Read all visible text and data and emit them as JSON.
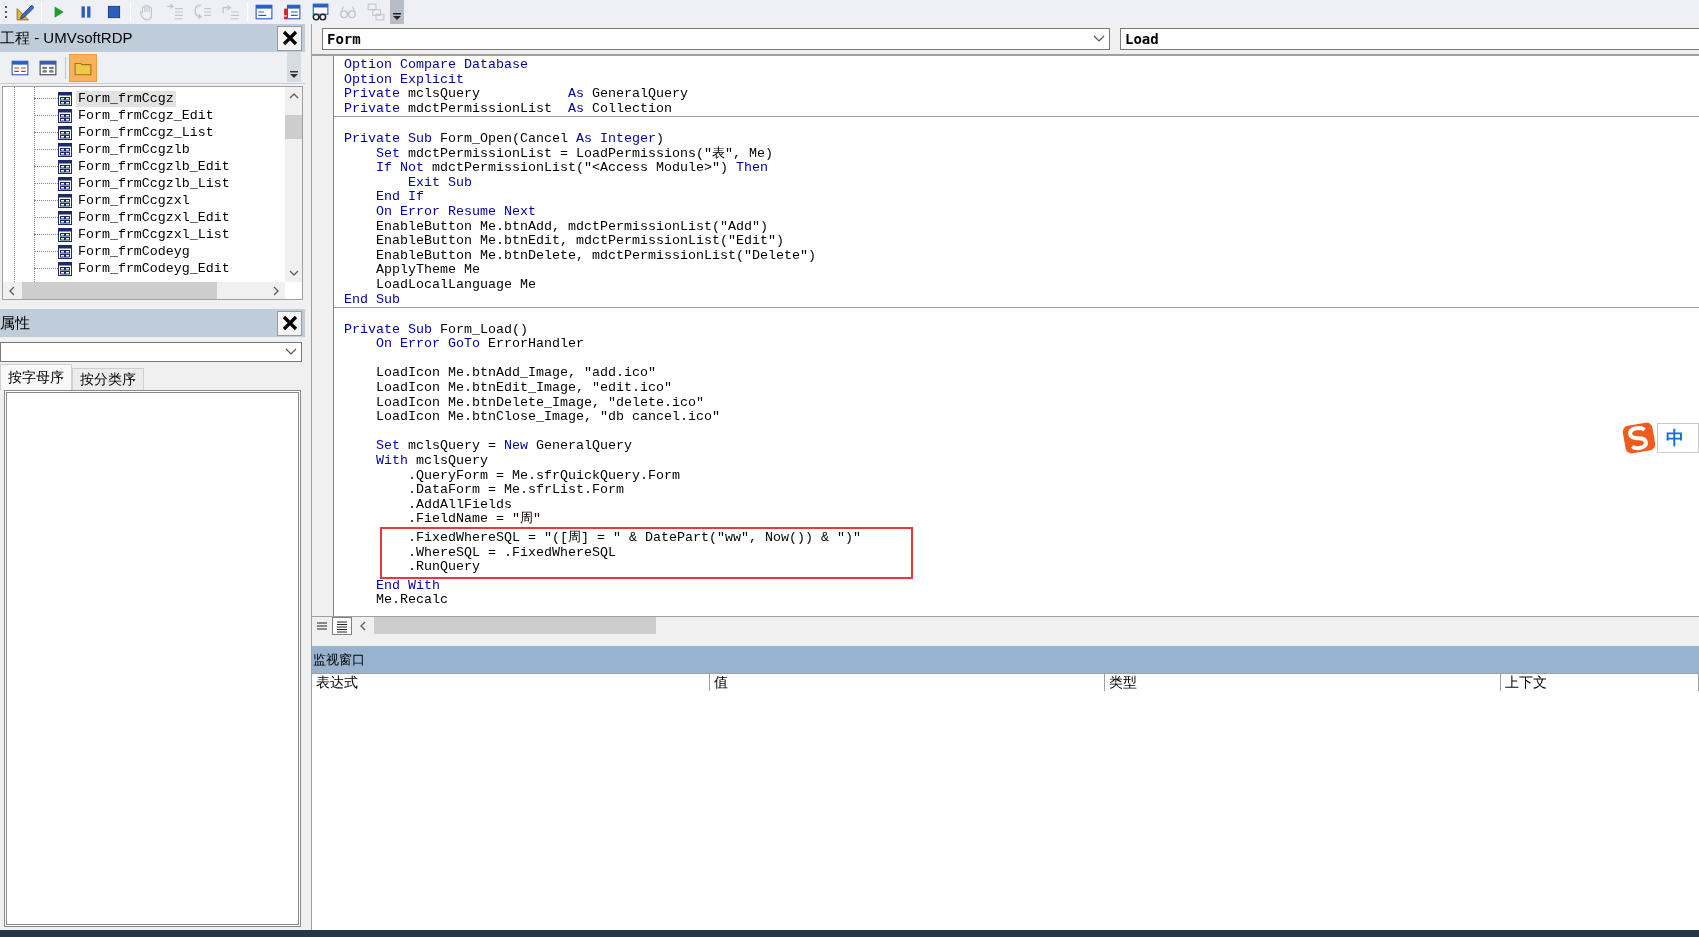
{
  "toolbar": [
    {
      "kind": "grip"
    },
    {
      "kind": "design",
      "disabled": false
    },
    {
      "kind": "separator"
    },
    {
      "kind": "run",
      "disabled": false
    },
    {
      "kind": "pause",
      "disabled": false
    },
    {
      "kind": "reset",
      "disabled": false
    },
    {
      "kind": "separator"
    },
    {
      "kind": "breakpoint",
      "disabled": true
    },
    {
      "kind": "step-into",
      "disabled": true
    },
    {
      "kind": "step-over",
      "disabled": true
    },
    {
      "kind": "step-out",
      "disabled": true
    },
    {
      "kind": "separator"
    },
    {
      "kind": "locals",
      "disabled": false
    },
    {
      "kind": "immediate",
      "disabled": false
    },
    {
      "kind": "watch",
      "disabled": false
    },
    {
      "kind": "quick-watch",
      "disabled": true
    },
    {
      "kind": "call-stack",
      "disabled": true
    }
  ],
  "project": {
    "title": "工程 - UMVsoftRDP",
    "toolbar": [
      {
        "kind": "view-code",
        "selected": false
      },
      {
        "kind": "view-object",
        "selected": false
      },
      {
        "kind": "toggle-folders",
        "selected": true
      }
    ],
    "items": [
      {
        "label": "Form_frmCcgz",
        "selected": true
      },
      {
        "label": "Form_frmCcgz_Edit",
        "selected": false
      },
      {
        "label": "Form_frmCcgz_List",
        "selected": false
      },
      {
        "label": "Form_frmCcgzlb",
        "selected": false
      },
      {
        "label": "Form_frmCcgzlb_Edit",
        "selected": false
      },
      {
        "label": "Form_frmCcgzlb_List",
        "selected": false
      },
      {
        "label": "Form_frmCcgzxl",
        "selected": false
      },
      {
        "label": "Form_frmCcgzxl_Edit",
        "selected": false
      },
      {
        "label": "Form_frmCcgzxl_List",
        "selected": false
      },
      {
        "label": "Form_frmCodeyg",
        "selected": false
      },
      {
        "label": "Form_frmCodeyg_Edit",
        "selected": false
      }
    ]
  },
  "properties": {
    "title": "属性",
    "tabs": [
      {
        "label": "按字母序",
        "selected": true
      },
      {
        "label": "按分类序",
        "selected": false
      }
    ]
  },
  "code_window": {
    "object": "Form",
    "procedure": "Load",
    "sections": [
      {
        "lines": [
          {
            "kind": "code",
            "tokens": [
              {
                "text": "Option Compare Database",
                "kind": "keyword"
              }
            ]
          },
          {
            "kind": "code",
            "tokens": [
              {
                "text": "Option Explicit",
                "kind": "keyword"
              }
            ]
          },
          {
            "kind": "code",
            "tokens": [
              {
                "text": "Private",
                "kind": "keyword"
              },
              {
                "text": " mclsQuery           ",
                "kind": "plain"
              },
              {
                "text": "As",
                "kind": "keyword"
              },
              {
                "text": " GeneralQuery",
                "kind": "plain"
              }
            ]
          },
          {
            "kind": "code",
            "tokens": [
              {
                "text": "Private",
                "kind": "keyword"
              },
              {
                "text": " mdctPermissionList  ",
                "kind": "plain"
              },
              {
                "text": "As",
                "kind": "keyword"
              },
              {
                "text": " Collection",
                "kind": "plain"
              }
            ]
          }
        ]
      },
      {
        "lines": [
          {
            "kind": "blank"
          },
          {
            "kind": "code",
            "tokens": [
              {
                "text": "Private Sub",
                "kind": "keyword"
              },
              {
                "text": " Form_Open(Cancel ",
                "kind": "plain"
              },
              {
                "text": "As Integer",
                "kind": "keyword"
              },
              {
                "text": ")",
                "kind": "plain"
              }
            ]
          },
          {
            "kind": "code",
            "tokens": [
              {
                "text": "    Set",
                "kind": "keyword"
              },
              {
                "text": " mdctPermissionList = LoadPermissions(\"表\", Me)",
                "kind": "plain"
              }
            ]
          },
          {
            "kind": "code",
            "tokens": [
              {
                "text": "    If Not",
                "kind": "keyword"
              },
              {
                "text": " mdctPermissionList(\"<Access Module>\") ",
                "kind": "plain"
              },
              {
                "text": "Then",
                "kind": "keyword"
              }
            ]
          },
          {
            "kind": "code",
            "tokens": [
              {
                "text": "        Exit Sub",
                "kind": "keyword"
              }
            ]
          },
          {
            "kind": "code",
            "tokens": [
              {
                "text": "    End If",
                "kind": "keyword"
              }
            ]
          },
          {
            "kind": "code",
            "tokens": [
              {
                "text": "    On Error Resume Next",
                "kind": "keyword"
              }
            ]
          },
          {
            "kind": "code",
            "tokens": [
              {
                "text": "    EnableButton Me.btnAdd, mdctPermissionList(\"Add\")",
                "kind": "plain"
              }
            ]
          },
          {
            "kind": "code",
            "tokens": [
              {
                "text": "    EnableButton Me.btnEdit, mdctPermissionList(\"Edit\")",
                "kind": "plain"
              }
            ]
          },
          {
            "kind": "code",
            "tokens": [
              {
                "text": "    EnableButton Me.btnDelete, mdctPermissionList(\"Delete\")",
                "kind": "plain"
              }
            ]
          },
          {
            "kind": "code",
            "tokens": [
              {
                "text": "    ApplyTheme Me",
                "kind": "plain"
              }
            ]
          },
          {
            "kind": "code",
            "tokens": [
              {
                "text": "    LoadLocalLanguage Me",
                "kind": "plain"
              }
            ]
          },
          {
            "kind": "code",
            "tokens": [
              {
                "text": "End Sub",
                "kind": "keyword"
              }
            ]
          }
        ]
      },
      {
        "lines": [
          {
            "kind": "blank"
          },
          {
            "kind": "code",
            "tokens": [
              {
                "text": "Private Sub",
                "kind": "keyword"
              },
              {
                "text": " Form_Load()",
                "kind": "plain"
              }
            ]
          },
          {
            "kind": "code",
            "tokens": [
              {
                "text": "    On Error GoTo",
                "kind": "keyword"
              },
              {
                "text": " ErrorHandler",
                "kind": "plain"
              }
            ]
          },
          {
            "kind": "blank"
          },
          {
            "kind": "code",
            "tokens": [
              {
                "text": "    LoadIcon Me.btnAdd_Image, \"add.ico\"",
                "kind": "plain"
              }
            ]
          },
          {
            "kind": "code",
            "tokens": [
              {
                "text": "    LoadIcon Me.btnEdit_Image, \"edit.ico\"",
                "kind": "plain"
              }
            ]
          },
          {
            "kind": "code",
            "tokens": [
              {
                "text": "    LoadIcon Me.btnDelete_Image, \"delete.ico\"",
                "kind": "plain"
              }
            ]
          },
          {
            "kind": "code",
            "tokens": [
              {
                "text": "    LoadIcon Me.btnClose_Image, \"db cancel.ico\"",
                "kind": "plain"
              }
            ]
          },
          {
            "kind": "blank"
          },
          {
            "kind": "code",
            "tokens": [
              {
                "text": "    Set",
                "kind": "keyword"
              },
              {
                "text": " mclsQuery = ",
                "kind": "plain"
              },
              {
                "text": "New",
                "kind": "keyword"
              },
              {
                "text": " GeneralQuery",
                "kind": "plain"
              }
            ]
          },
          {
            "kind": "code",
            "tokens": [
              {
                "text": "    With",
                "kind": "keyword"
              },
              {
                "text": " mclsQuery",
                "kind": "plain"
              }
            ]
          },
          {
            "kind": "code",
            "tokens": [
              {
                "text": "        .QueryForm = Me.sfrQuickQuery.Form",
                "kind": "plain"
              }
            ]
          },
          {
            "kind": "code",
            "tokens": [
              {
                "text": "        .DataForm = Me.sfrList.Form",
                "kind": "plain"
              }
            ]
          },
          {
            "kind": "code",
            "tokens": [
              {
                "text": "        .AddAllFields",
                "kind": "plain"
              }
            ]
          },
          {
            "kind": "code",
            "tokens": [
              {
                "text": "        .FieldName = \"周\"",
                "kind": "plain"
              }
            ]
          },
          {
            "kind": "boxed",
            "tokens": [
              {
                "text": "        .FixedWhereSQL = \"([周] = \" & DatePart(\"ww\", Now()) & \")\"",
                "kind": "plain"
              }
            ]
          },
          {
            "kind": "boxed",
            "tokens": [
              {
                "text": "        .WhereSQL = .FixedWhereSQL",
                "kind": "plain"
              }
            ]
          },
          {
            "kind": "boxed",
            "tokens": [
              {
                "text": "        .RunQuery",
                "kind": "plain"
              }
            ]
          },
          {
            "kind": "code",
            "tokens": [
              {
                "text": "    End With",
                "kind": "keyword"
              }
            ]
          },
          {
            "kind": "code",
            "tokens": [
              {
                "text": "    Me.Recalc",
                "kind": "plain"
              }
            ]
          }
        ]
      }
    ],
    "view_buttons": [
      {
        "kind": "procedure",
        "selected": false
      },
      {
        "kind": "module",
        "selected": true
      }
    ]
  },
  "watch_window": {
    "title": "监视窗口",
    "columns": [
      "表达式",
      "值",
      "类型",
      "上下文"
    ]
  },
  "ime_indicator": {
    "label": "中"
  }
}
